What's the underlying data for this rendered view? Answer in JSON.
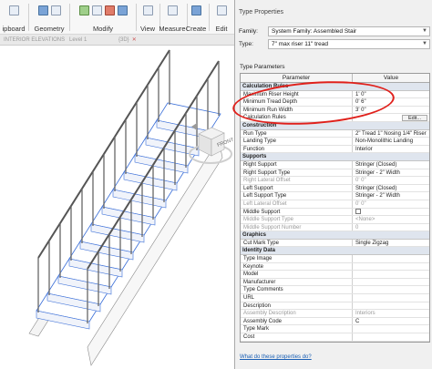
{
  "ribbon": {
    "groups": [
      {
        "label": "ipboard"
      },
      {
        "label": "Geometry"
      },
      {
        "label": "Modify"
      },
      {
        "label": "View"
      },
      {
        "label": "Measure"
      },
      {
        "label": "Create"
      },
      {
        "label": "Edit"
      }
    ]
  },
  "view_tabs": [
    {
      "label": "INTERIOR ELEVATIONS"
    },
    {
      "label": "Level 1"
    },
    {
      "label": "{3D}"
    }
  ],
  "viewcube": {
    "face_label": "FRONT"
  },
  "dialog": {
    "title": "Type Properties",
    "family_label": "Family:",
    "family_value": "System Family: Assembled Stair",
    "type_label": "Type:",
    "type_value": "7\" max riser 11\" tread",
    "type_parameters_label": "Type Parameters",
    "col_parameter": "Parameter",
    "col_value": "Value",
    "edit_label": "Edit...",
    "help_link": "What do these properties do?",
    "sections": [
      {
        "name": "Calculation Rules",
        "rows": [
          {
            "name": "Maximum Riser Height",
            "value": "1' 0\""
          },
          {
            "name": "Minimum Tread Depth",
            "value": "0' 6\""
          },
          {
            "name": "Minimum Run Width",
            "value": "3' 0\""
          },
          {
            "name": "Calculation Rules",
            "value": ""
          }
        ]
      },
      {
        "name": "Construction",
        "rows": [
          {
            "name": "Run Type",
            "value": "2\" Tread 1\" Nosing 1/4\" Riser"
          },
          {
            "name": "Landing Type",
            "value": "Non-Monolithic Landing"
          },
          {
            "name": "Function",
            "value": "Interior"
          }
        ]
      },
      {
        "name": "Supports",
        "rows": [
          {
            "name": "Right Support",
            "value": "Stringer (Closed)"
          },
          {
            "name": "Right Support Type",
            "value": "Stringer - 2\" Width"
          },
          {
            "name": "Right Lateral Offset",
            "value": "0' 0\""
          },
          {
            "name": "Left Support",
            "value": "Stringer (Closed)"
          },
          {
            "name": "Left Support Type",
            "value": "Stringer - 2\" Width"
          },
          {
            "name": "Left Lateral Offset",
            "value": "0' 0\""
          },
          {
            "name": "Middle Support",
            "value": ""
          },
          {
            "name": "Middle Support Type",
            "value": "<None>"
          },
          {
            "name": "Middle Support Number",
            "value": "0"
          }
        ]
      },
      {
        "name": "Graphics",
        "rows": [
          {
            "name": "Cut Mark Type",
            "value": "Single Zigzag"
          }
        ]
      },
      {
        "name": "Identity Data",
        "rows": [
          {
            "name": "Type Image",
            "value": ""
          },
          {
            "name": "Keynote",
            "value": ""
          },
          {
            "name": "Model",
            "value": ""
          },
          {
            "name": "Manufacturer",
            "value": ""
          },
          {
            "name": "Type Comments",
            "value": ""
          },
          {
            "name": "URL",
            "value": ""
          },
          {
            "name": "Description",
            "value": ""
          },
          {
            "name": "Assembly Description",
            "value": "Interiors"
          },
          {
            "name": "Assembly Code",
            "value": "C"
          },
          {
            "name": "Type Mark",
            "value": ""
          },
          {
            "name": "Cost",
            "value": ""
          }
        ]
      }
    ]
  },
  "colors": {
    "highlight_annotation": "#e0201b",
    "selection_blue": "#3b6fd8"
  }
}
